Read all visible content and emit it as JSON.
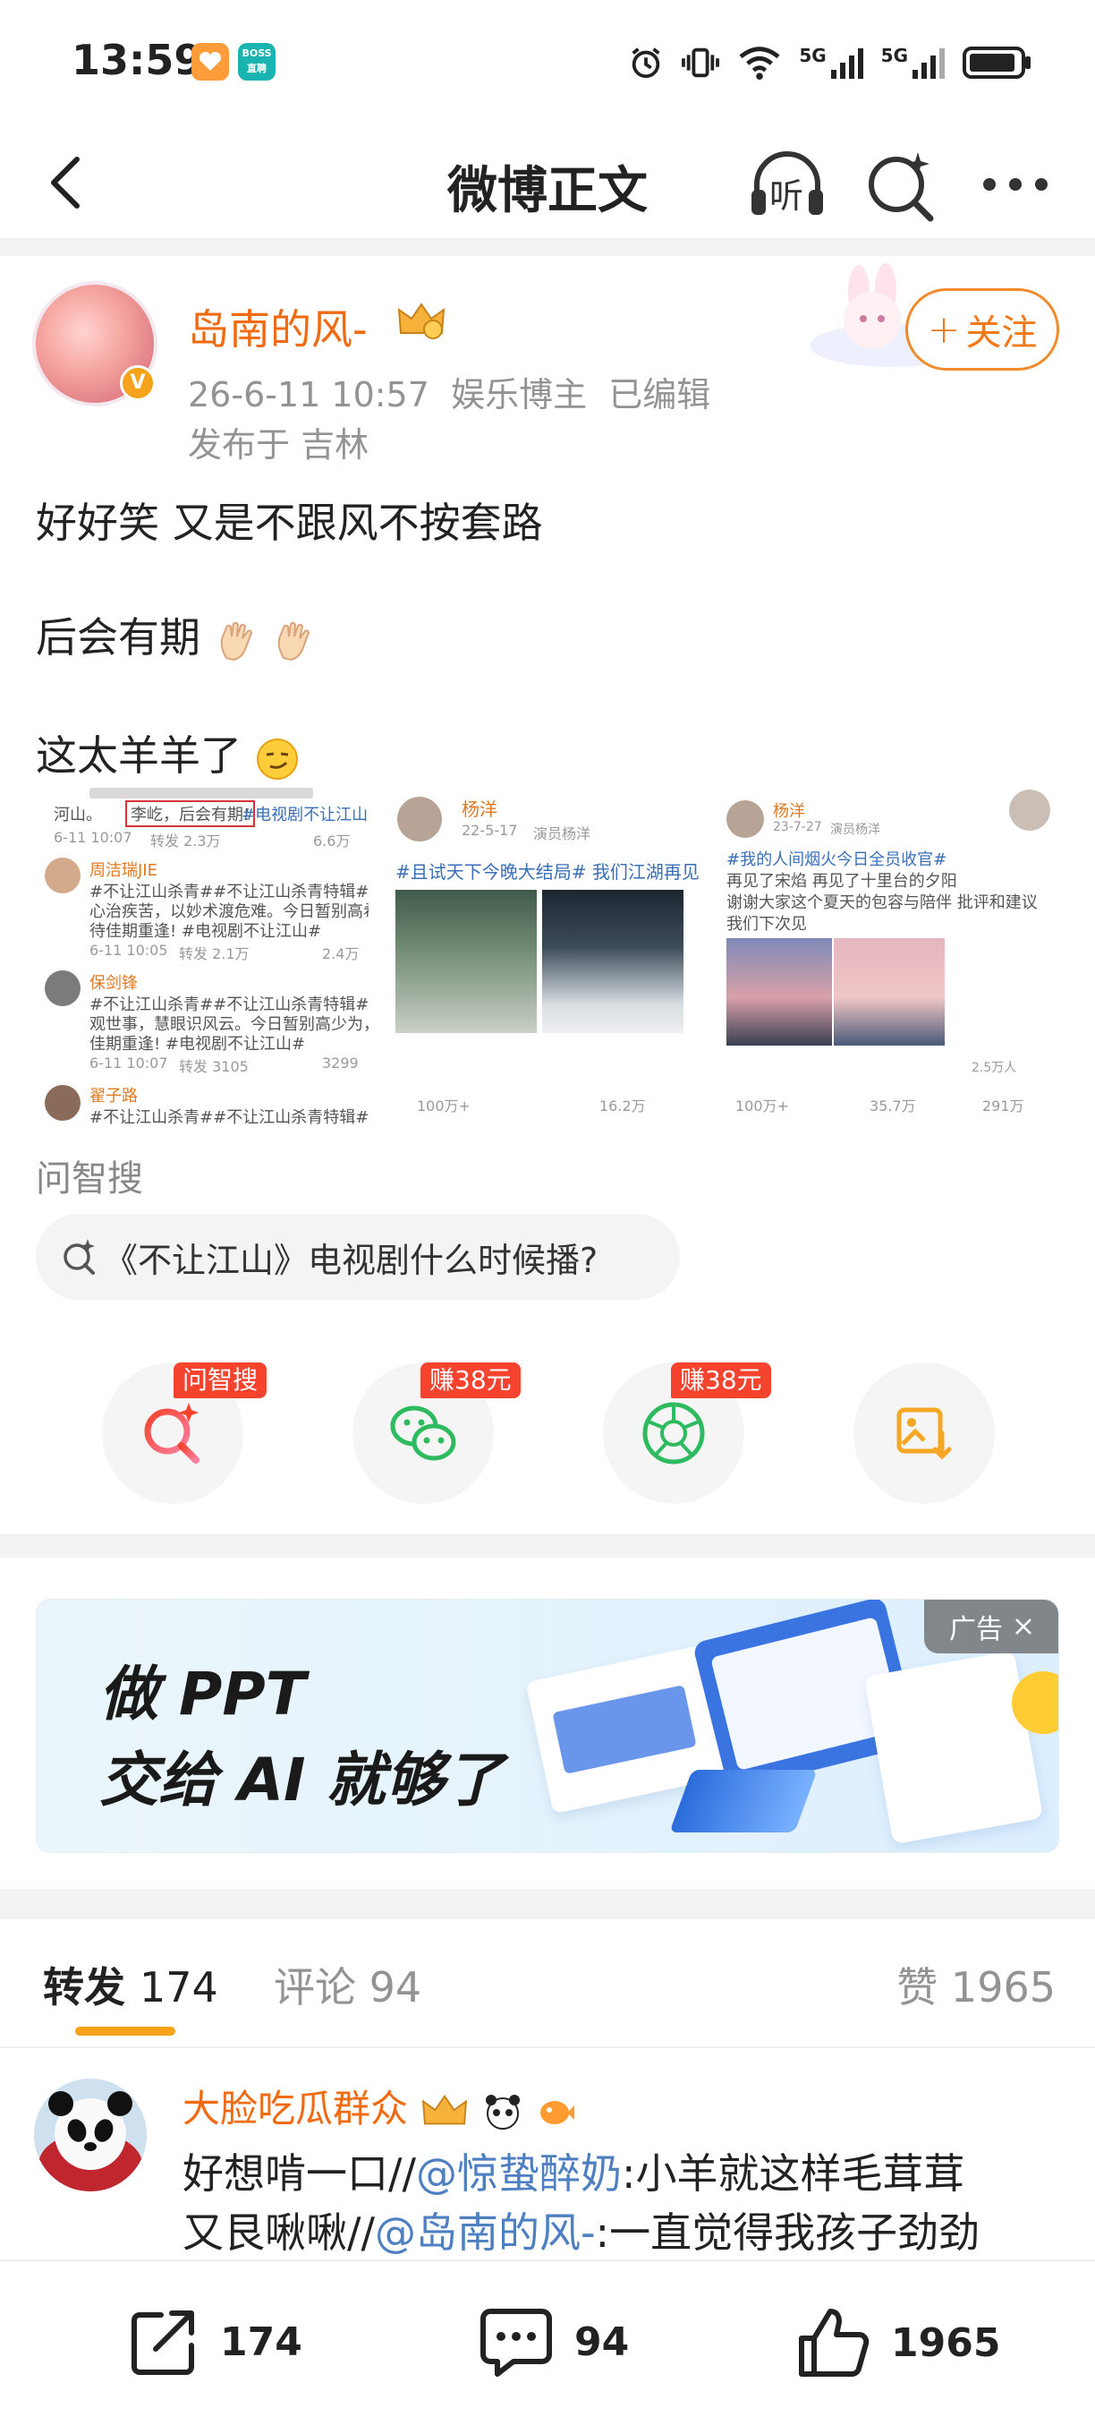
{
  "status_bar": {
    "time": "13:59",
    "app_badge_text": "BOSS直聘",
    "signal_1": "5G",
    "signal_2": "5G"
  },
  "header": {
    "title": "微博正文",
    "listen_label": "听"
  },
  "post": {
    "author": "岛南的风-",
    "date": "26-6-11 10:57",
    "author_role": "娱乐博主",
    "edited": "已编辑",
    "location": "发布于 吉林",
    "follow_label": "关注",
    "lines": [
      "好好笑  又是不跟风不按套路",
      "后会有期",
      "这太羊羊了"
    ]
  },
  "images": {
    "img1": {
      "top_text": "河山。",
      "highlight": "李屹，后会有期!",
      "hashtag_1": "#电视剧不让江山#",
      "meta_1": "6-11 10:07",
      "repost_1": "转发 2.3万",
      "likes_1": "6.6万",
      "user_2": "周洁瑞JIE",
      "text_2a": "#不让江山杀青##不让江山杀青特辑# 以仁",
      "text_2b": "心治疾苦，以妙术渡危难。今日暂别高希宁，",
      "text_2c": "待佳期重逢! #电视剧不让江山#",
      "meta_2": "6-11 10:05",
      "repost_2": "转发 2.1万",
      "likes_2": "2.4万",
      "user_3": "保剑锋",
      "text_3a": "#不让江山杀青##不让江山杀青特辑# 明心",
      "text_3b": "观世事，慧眼识风云。今日暂别高少为，待",
      "text_3c": "佳期重逢! #电视剧不让江山#",
      "meta_3": "6-11 10:07",
      "repost_3": "转发 3105",
      "likes_3": "3299",
      "user_4": "翟子路",
      "text_4": "#不让江山杀青##不让江山杀青特辑# 拔锋"
    },
    "img2": {
      "user": "杨洋",
      "date": "22-5-17",
      "role": "演员杨洋",
      "text": "#且试天下今晚大结局# 我们江湖再见",
      "repost": "100万+",
      "comments": "16.2万"
    },
    "img3": {
      "user": "杨洋",
      "date": "23-7-27",
      "role": "演员杨洋",
      "text_a": "#我的人间烟火今日全员收官#",
      "text_b": "再见了宋焰 再见了十里台的夕阳",
      "text_c": "谢谢大家这个夏天的包容与陪伴 批评和建议",
      "text_d": "我们下次见",
      "small_likes": "2.5万人",
      "repost": "100万+",
      "comments": "35.7万",
      "likes": "291万"
    }
  },
  "wenzhisou": {
    "label": "问智搜",
    "query": "《不让江山》电视剧什么时候播?"
  },
  "actions": [
    {
      "tag": "问智搜",
      "icon": "ai-search-icon"
    },
    {
      "tag": "赚38元",
      "icon": "wechat-icon"
    },
    {
      "tag": "赚38元",
      "icon": "moments-icon"
    },
    {
      "tag": "",
      "icon": "save-image-icon"
    }
  ],
  "ad": {
    "line1": "做 PPT",
    "line2": "交给 AI 就够了",
    "tag": "广告"
  },
  "tabs": {
    "repost_label": "转发",
    "repost_count": "174",
    "comment_label": "评论",
    "comment_count": "94",
    "like_label": "赞",
    "like_count": "1965"
  },
  "repost_item": {
    "name": "大脸吃瓜群众",
    "line1_a": "好想啃一口//",
    "line1_mention": "@惊蛰醉奶",
    "line1_b": ":小羊就这样毛茸茸",
    "line2_a": "又艮啾啾//",
    "line2_mention": "@岛南的风-",
    "line2_b": ":一直觉得我孩子劲劲"
  },
  "bottom_bar": {
    "repost": "174",
    "comment": "94",
    "like": "1965"
  },
  "colors": {
    "accent_orange": "#f06a12",
    "mention_blue": "#4d7fc1",
    "tag_red": "#f5432d",
    "tab_underline": "#f7a21b"
  }
}
